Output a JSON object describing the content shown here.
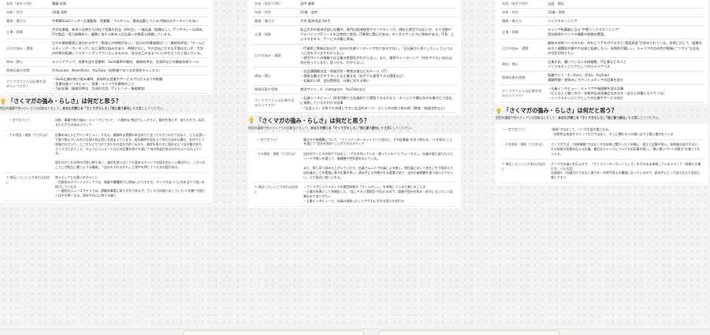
{
  "columns": [
    {
      "profile": [
        {
          "k": "名前（仮名でOK）",
          "v": "齋藤 拓哉"
        },
        {
          "k": "年齢・性別",
          "v": "28歳 男性"
        },
        {
          "k": "職業・働き方",
          "v": "中規模SaaSベンダー企業勤務　営業職／フルタイム／基本出勤しているが微妙はオンラインもあい"
        },
        {
          "k": "立場・経験",
          "v": "大学卒業後、新卒入社時から同社で営業を担当（4年目）。一般社員（役職なし）。ITリテラシーは高め。ITの製品・導入経験あり。複数にあたる新卒入社社員への指導も経験しているる。"
        },
        {
          "k": "日々の悩み・課題",
          "v": "日々の業務範囲に迷われる中で『勉強との時間がない』『自分の市場価値は？』『業務効率化』『チームビルディング・コーチング』など漠然な悩みがあり、時間がない。今の会社に大きな不満はないが、大学の同期は転職してスタートアップでいたいるみるみ、自分は乙のままでいいのだろうかと悩んでいる。"
        },
        {
          "k": "興味・関心",
          "v": "キャリアアップ、成果を出す営業術、SaaS業界の動向、業務効率化、生成AIなどの最新技術ツール"
        },
        {
          "k": "情報収集の習慣",
          "v": "X/Youtube、NewsPicks、YouTube（短時間で学べる学習系チャンネル）"
        },
        {
          "k": "さくマガでどんな記事を読みたいですか？",
          "v": "・SaaS企業の取り組み事例、具体的な営業やサービスプロセスまでの経験\n・営業社員インタビュー：営業・キャリアの最新のこと\n・Tips記事（業務効率化、生成AI活用、ITトレンド・業務解説）"
        }
      ],
      "section": {
        "title": "「さくマガの強み・らしさ」は何だと思う？",
        "desc_pre": "前回の議論や他メディアとの比較なとをして、",
        "desc_bold": "あなたが感じる「さくマガらしさ」「他と違う部分」",
        "desc_post": "を言葉にしてください。"
      },
      "qa": [
        {
          "q": "・一言で言うと？",
          "a": "技術・事業や取り組み・キャリアについて、\"人間的な\"視点でしっかりと。肩肘を張らず、あたたかさ。伝わるたたかさのあるメディア"
        },
        {
          "q": "・その理由・根拠（できれば）",
          "a": "記事のほとんどがインタビュー。それも、業務的な実績の本当本りと言ってもちうわけではなく、どんな思いで取り組んでいるのかな個人的な思いを捉まえています。成功事例を捉まえて何のための仕事か。社内でどう評価されていて、どこかたどりつけてきたかの見方が良く伝わり、肩肘を張らずに読めるような印象があり、さくマガとおりこと、ちょうどいいヒントなどの記事を紹介を通じて何の利益があるのかもよく伝わってくる。\n\n読むのがこれの持ちが良い時も多く、肩肘を張らなくても読めるキャリアの話を何らしい視点から、こちらのことにが相互に響くような構成。「自分もやれるかも」と背中を押してくれる内容がある。"
        },
        {
          "q": "✎ 補足したいことがあれば自由に",
          "a": "他メディアとの違いのポイント\n・目前系のオウンドメディアでは、制度や職種紹介に終始したりすかき、さくマガは\"人\"に光を当てて思いを紹介してくれる\n・一般的なニュースサイトでは、客観的事実に寄りがちであるが、さくマガは個人のこうした\"人の数\"で読む人はやや熱くなる。読み手の心に刺さる感じ"
        }
      ]
    },
    {
      "profile": [
        {
          "k": "名前（仮名でOK）",
          "v": "田中 美咲"
        },
        {
          "k": "年齢・性別",
          "v": "21歳　女性"
        },
        {
          "k": "職業・働き方",
          "v": "大学 経済学部 3年生"
        },
        {
          "k": "立場・経験",
          "v": "私立大学の経済学部に在籍中。専門は経済経営やマーケティング。現在も就活ではないが、ゼミ活動やアルバイトでITツールを日常的に使用。IT業界に関心がある。デジタルサービスに興味がある。IT系、ビジネスモデル、サービスの裏に興味。"
        },
        {
          "k": "日々の悩み・課題",
          "v": "・IT業界に興味はあるが、自分の志望インターンが何であるかない。「正社員から良くしたい」というように何をすべきかわからない。\n・就活サイトの情報では企業の雰囲気がわからない。また、業界やインターンで「何をやりたい自分は何が合っているか」見つかる、わからない。"
        },
        {
          "k": "興味・関心",
          "v": "・社会課題解決型・地域活性・教育支援などのテーマ（IT）\n・柔軟な働き方やフラットな企業文化（若手でも意見できる環境など）\n・社員の人柄、会社雰囲気、仕事に対する想い"
        },
        {
          "k": "情報収集の習慣",
          "v": "就活サイト、X、Instagram、YouTubeなど"
        },
        {
          "k": "さくマガでどんな記事を読みたいですか？",
          "v": "・社員インタビュー！採用活動でも社員紹介で閲覧できるかなら、エンジニア職以外の仕事がどう会社に貢献しているかわかる記事\n・「社会と人」文系でも共感しやすい社会的テーマ：さくらのの取り組み例（教育、地域活性など）"
        }
      ],
      "section": {
        "title": "「さくマガの強み・らしさ」は何だと思う？",
        "desc_pre": "前回の議論や他メディアとの比較なとをして、",
        "desc_bold": "あなたが感じる「さくマガらしさ」「他と違う部分」",
        "desc_post": "を言葉にしてください。"
      },
      "qa": [
        {
          "q": "・一言で言うと？",
          "a": "働き方や価値観について、\"さくらインターネットという会社と、その従業員\"を深く探れる。\"人を知る\"ことを通じて\"会社を知る\"ことができるメディア"
        },
        {
          "q": "・その理由・根拠（できれば）",
          "a": "自社のサービスの紹介ではなく、\"それを作っている・使っている人\"にフォーカスし、社員の振り返りもエピソードや想いを通じて、価値観や空気感を伝えている。\n\nまた、寄り添う読みも上がっていたり、社員さん二人で社員による感じ。他社員に対してあちこちで読めたり自社員のことを素直に表す記事が多い。読み手にも共感される要素があり、自分の価値観を振り返らせてもらい、より身近に感じられる。"
        },
        {
          "q": "✎ 補足したいことがあれば自由に",
          "a": "・さくマガというメディアの運営体制が「さくらのしぃ」を体現していると感じることが、\n・企業の成果として多様化した、\"話しやすい雰囲気\"が伝わるので、読者が会社を知る・好きになっていく記事なのでありがたい\n・企業インタビューで、社員の頑張ったことやそれに対する思いを知れる"
        }
      ]
    },
    {
      "profile": [
        {
          "k": "名前（仮名でOK）",
          "v": "山田　翔太"
        },
        {
          "k": "年齢・性別",
          "v": "32歳・男性"
        },
        {
          "k": "職業・働き方",
          "v": "インフラエンジニア"
        },
        {
          "k": "立場・経験",
          "v": "キャリア転職者になる\"中堅インフラエンジニア\"\n受託開発やインフラ構築の経験は豊富。"
        },
        {
          "k": "日々の悩み・課題",
          "v": "最新の技術ベースのため、何をどう手を付けるかと\"感度高度\"が求められている。技術に対して、組織文化や人間関係が鍵やや全部に配慮したい。長期的が嬉しい。キャリアの方向性が曖昧に\"リアル\"な会社の空気が知りたい"
        },
        {
          "k": "興味・関心",
          "v": "企業文化、働いている人の価値観、IT企業などの人と\nインフラエンジニアとしてのキャリアパス"
        },
        {
          "k": "情報収集の習慣",
          "v": "転職サイト・X・Zenn、Qiita、YouTube\n通勤時間・昼休みにオウンドメディアの記事を読む"
        },
        {
          "k": "さくマガでどんな記事を読みたいですか？",
          "v": "・社員インタビュー：キャリアや価値観を語る記事\n（どんな人と働くのか・技術的な成長機会はあるか・自分と同業になりそうな）\n・インフラエンジニアとしての仕事やサービス紹介"
        }
      ],
      "section": {
        "title": "「さくマガの強み・らしさ」は何だと思う？",
        "desc_pre": "前回の議論や他メディアとの比較なとをして、",
        "desc_bold": "あなたが感じる「さくマガらしさ」「他と違う部分」",
        "desc_post": "を言葉にしてください。"
      },
      "qa": [
        {
          "q": "・一言で言うと？",
          "a": "\"欲張\"ではなくて、\"人\"が主役の場となる。\n・技術的な成長やマインドだけではなく、そこに関わる人の想いまで丁寧に書かれている"
        },
        {
          "q": "・その理由・根拠（できれば）",
          "a": "さくマガでは、\"技術情報\"ではなくその技術に関わった人を軸に、組立と記事が多い。技術者自身がその人、その技術の背景を伝える記事。最近なキャリアについてもの記事が多い。\"熱い想い\"や\"人の動き\"を感じてもらえる。"
        },
        {
          "q": "✎ 補足したいことがあれば自由に",
          "a": "さくマガの違いを伝え方で、「さくらインターネットらしさ」をそのまま体現しているメディア（技術も大事だが、人も大切）\n社員個人（社員だけではなく周りを）の押が見える構成になっているので、読み手にとって自らがより身近に感じやすい"
        }
      ]
    }
  ]
}
